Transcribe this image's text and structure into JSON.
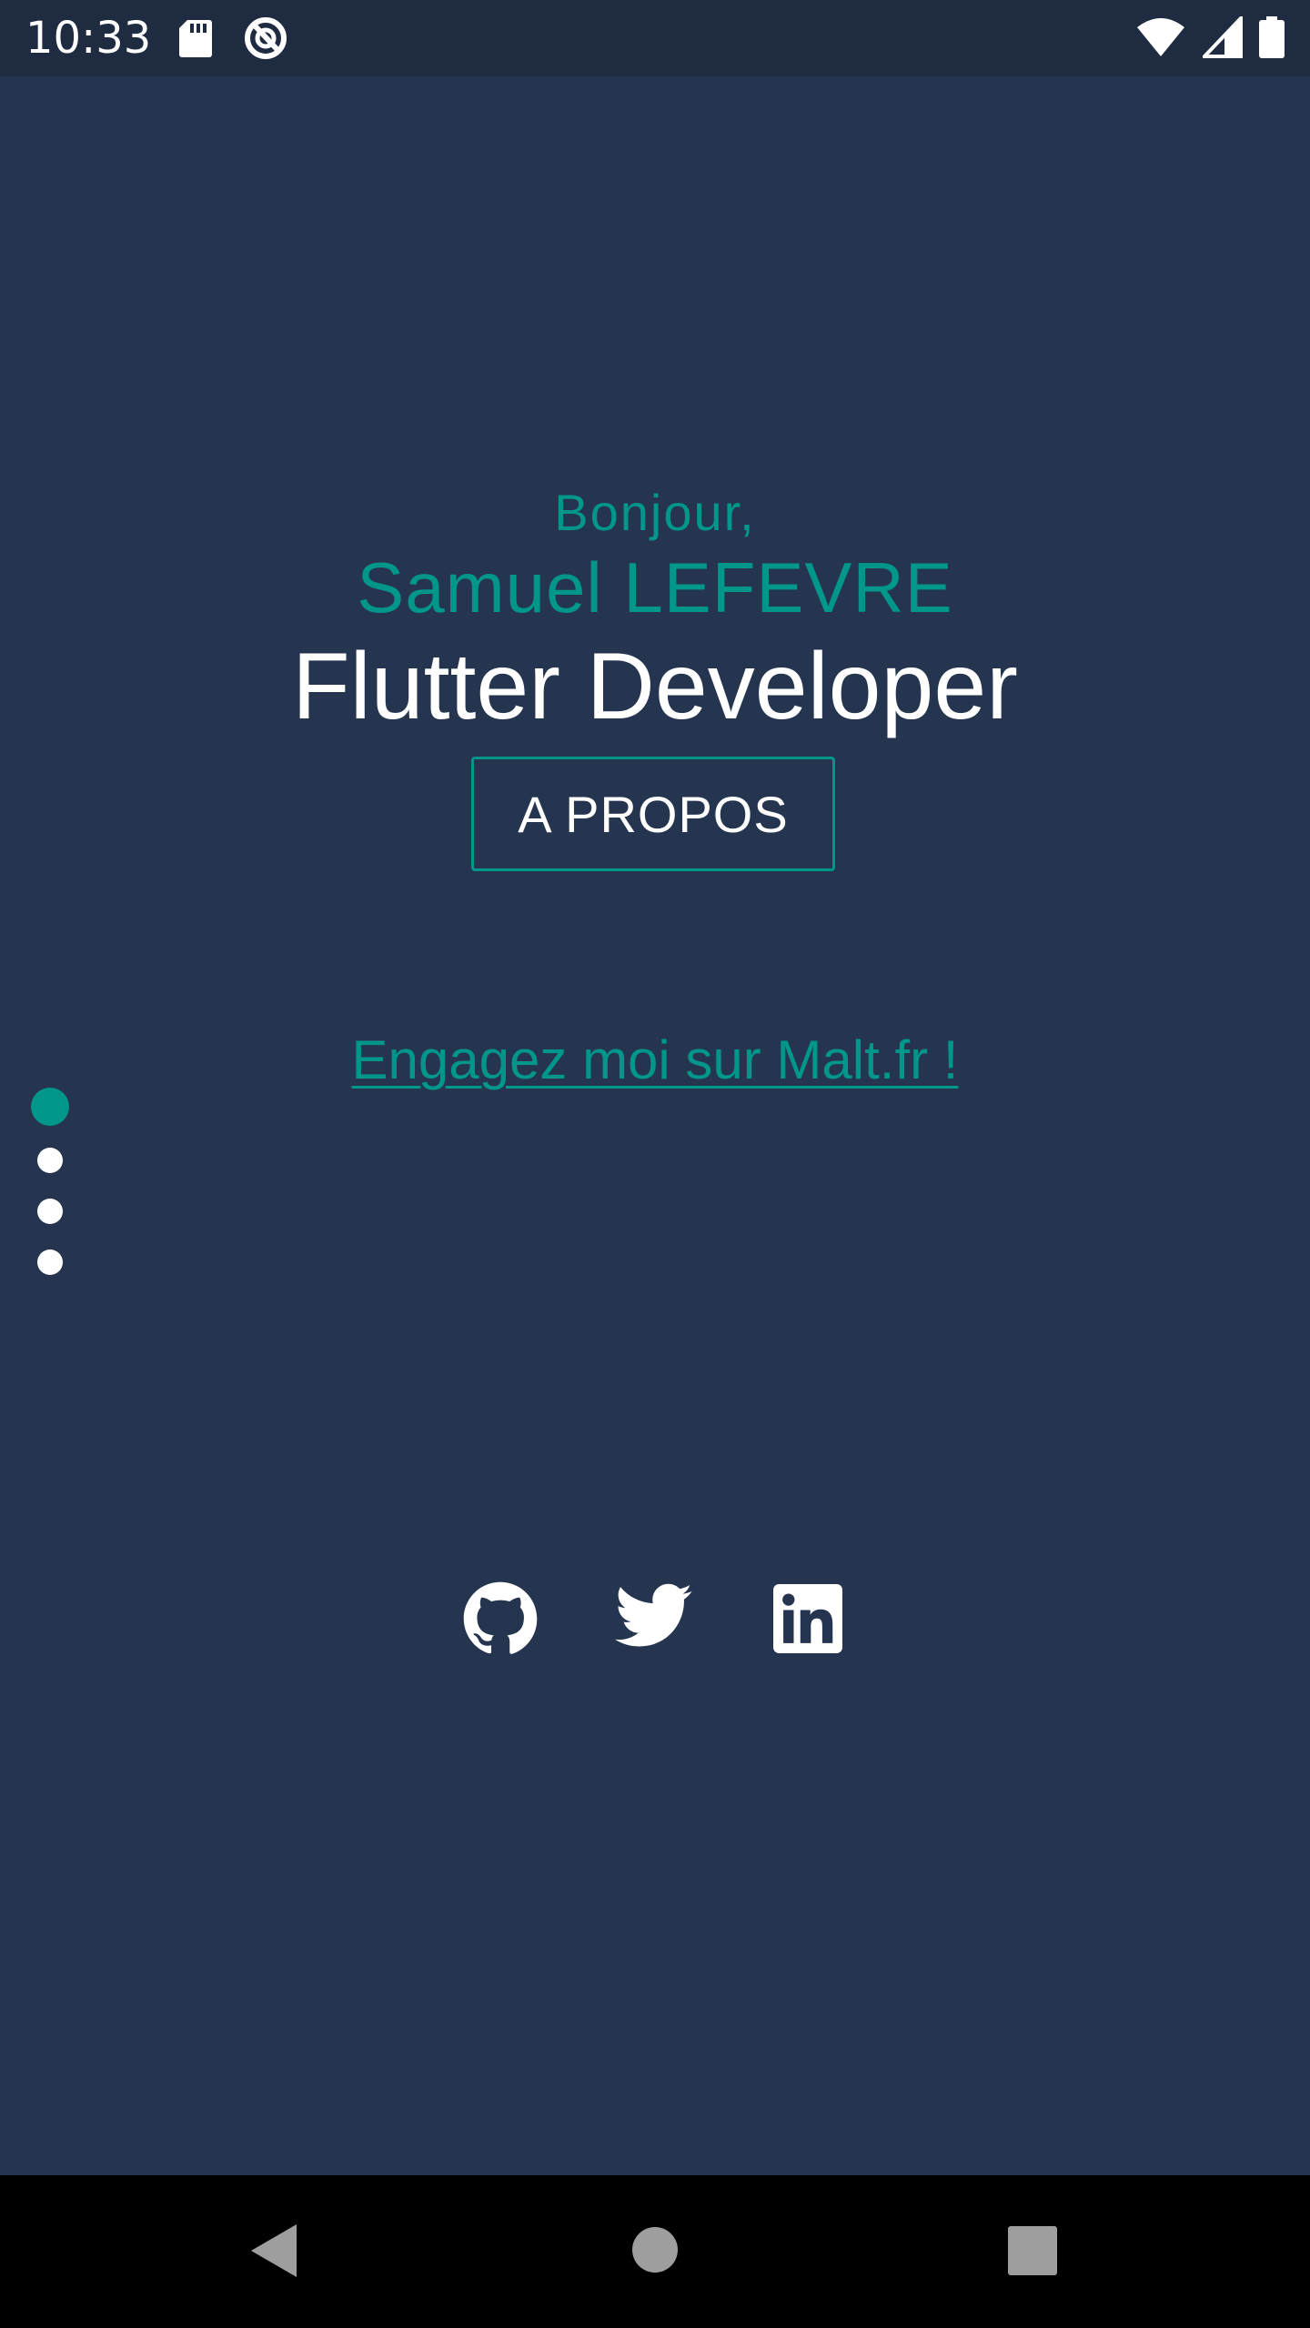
{
  "status_bar": {
    "time": "10:33",
    "icons": [
      "sd-card-icon",
      "sync-icon",
      "wifi-icon",
      "signal-icon",
      "battery-icon"
    ]
  },
  "hero": {
    "greeting": "Bonjour,",
    "name": "Samuel LEFEVRE",
    "role": "Flutter Developer",
    "about_button": "A PROPOS",
    "malt_link": "Engagez moi sur Malt.fr !"
  },
  "page_indicator": {
    "count": 4,
    "active_index": 0
  },
  "social_links": [
    {
      "name": "github",
      "icon": "github-icon"
    },
    {
      "name": "twitter",
      "icon": "twitter-icon"
    },
    {
      "name": "linkedin",
      "icon": "linkedin-icon"
    }
  ],
  "navigation_bar": {
    "buttons": [
      "back",
      "home",
      "recents"
    ]
  },
  "colors": {
    "background": "#25354F",
    "status_bar": "#1E2B40",
    "accent": "#00968A",
    "text": "#FFFFFF",
    "nav_bar": "#000000"
  }
}
